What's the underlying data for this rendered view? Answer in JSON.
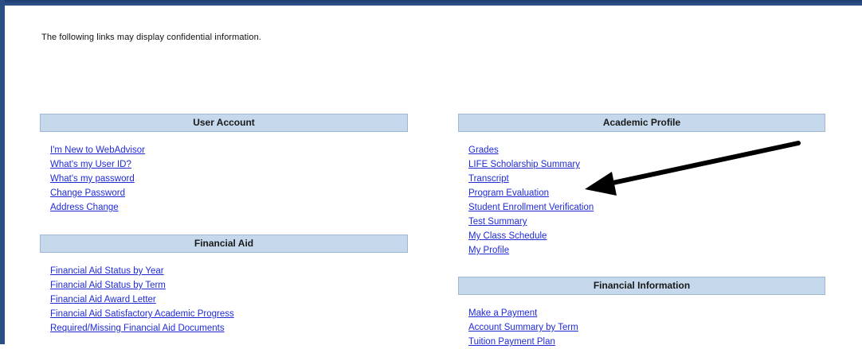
{
  "notice": "The following links may display confidential information.",
  "sections": {
    "user_account": {
      "title": "User Account",
      "links": [
        "I'm New to WebAdvisor",
        "What's my User ID?",
        "What's my password",
        "Change Password",
        "Address Change"
      ]
    },
    "financial_aid": {
      "title": "Financial Aid",
      "links": [
        "Financial Aid Status by Year",
        "Financial Aid Status by Term",
        "Financial Aid Award Letter",
        "Financial Aid Satisfactory Academic Progress",
        "Required/Missing Financial Aid Documents"
      ]
    },
    "academic_profile": {
      "title": "Academic Profile",
      "links": [
        "Grades",
        "LIFE Scholarship Summary",
        "Transcript",
        "Program Evaluation",
        "Student Enrollment Verification",
        "Test Summary",
        "My Class Schedule",
        "My Profile"
      ]
    },
    "financial_information": {
      "title": "Financial Information",
      "links": [
        "Make a Payment",
        "Account Summary by Term",
        "Tuition Payment Plan"
      ]
    }
  },
  "colors": {
    "header_bg": "#c5d8ec",
    "link": "#1f2ad6",
    "frame_border": "#2a4f86"
  },
  "annotation": {
    "icon": "arrow-icon",
    "points_to": "Program Evaluation"
  }
}
